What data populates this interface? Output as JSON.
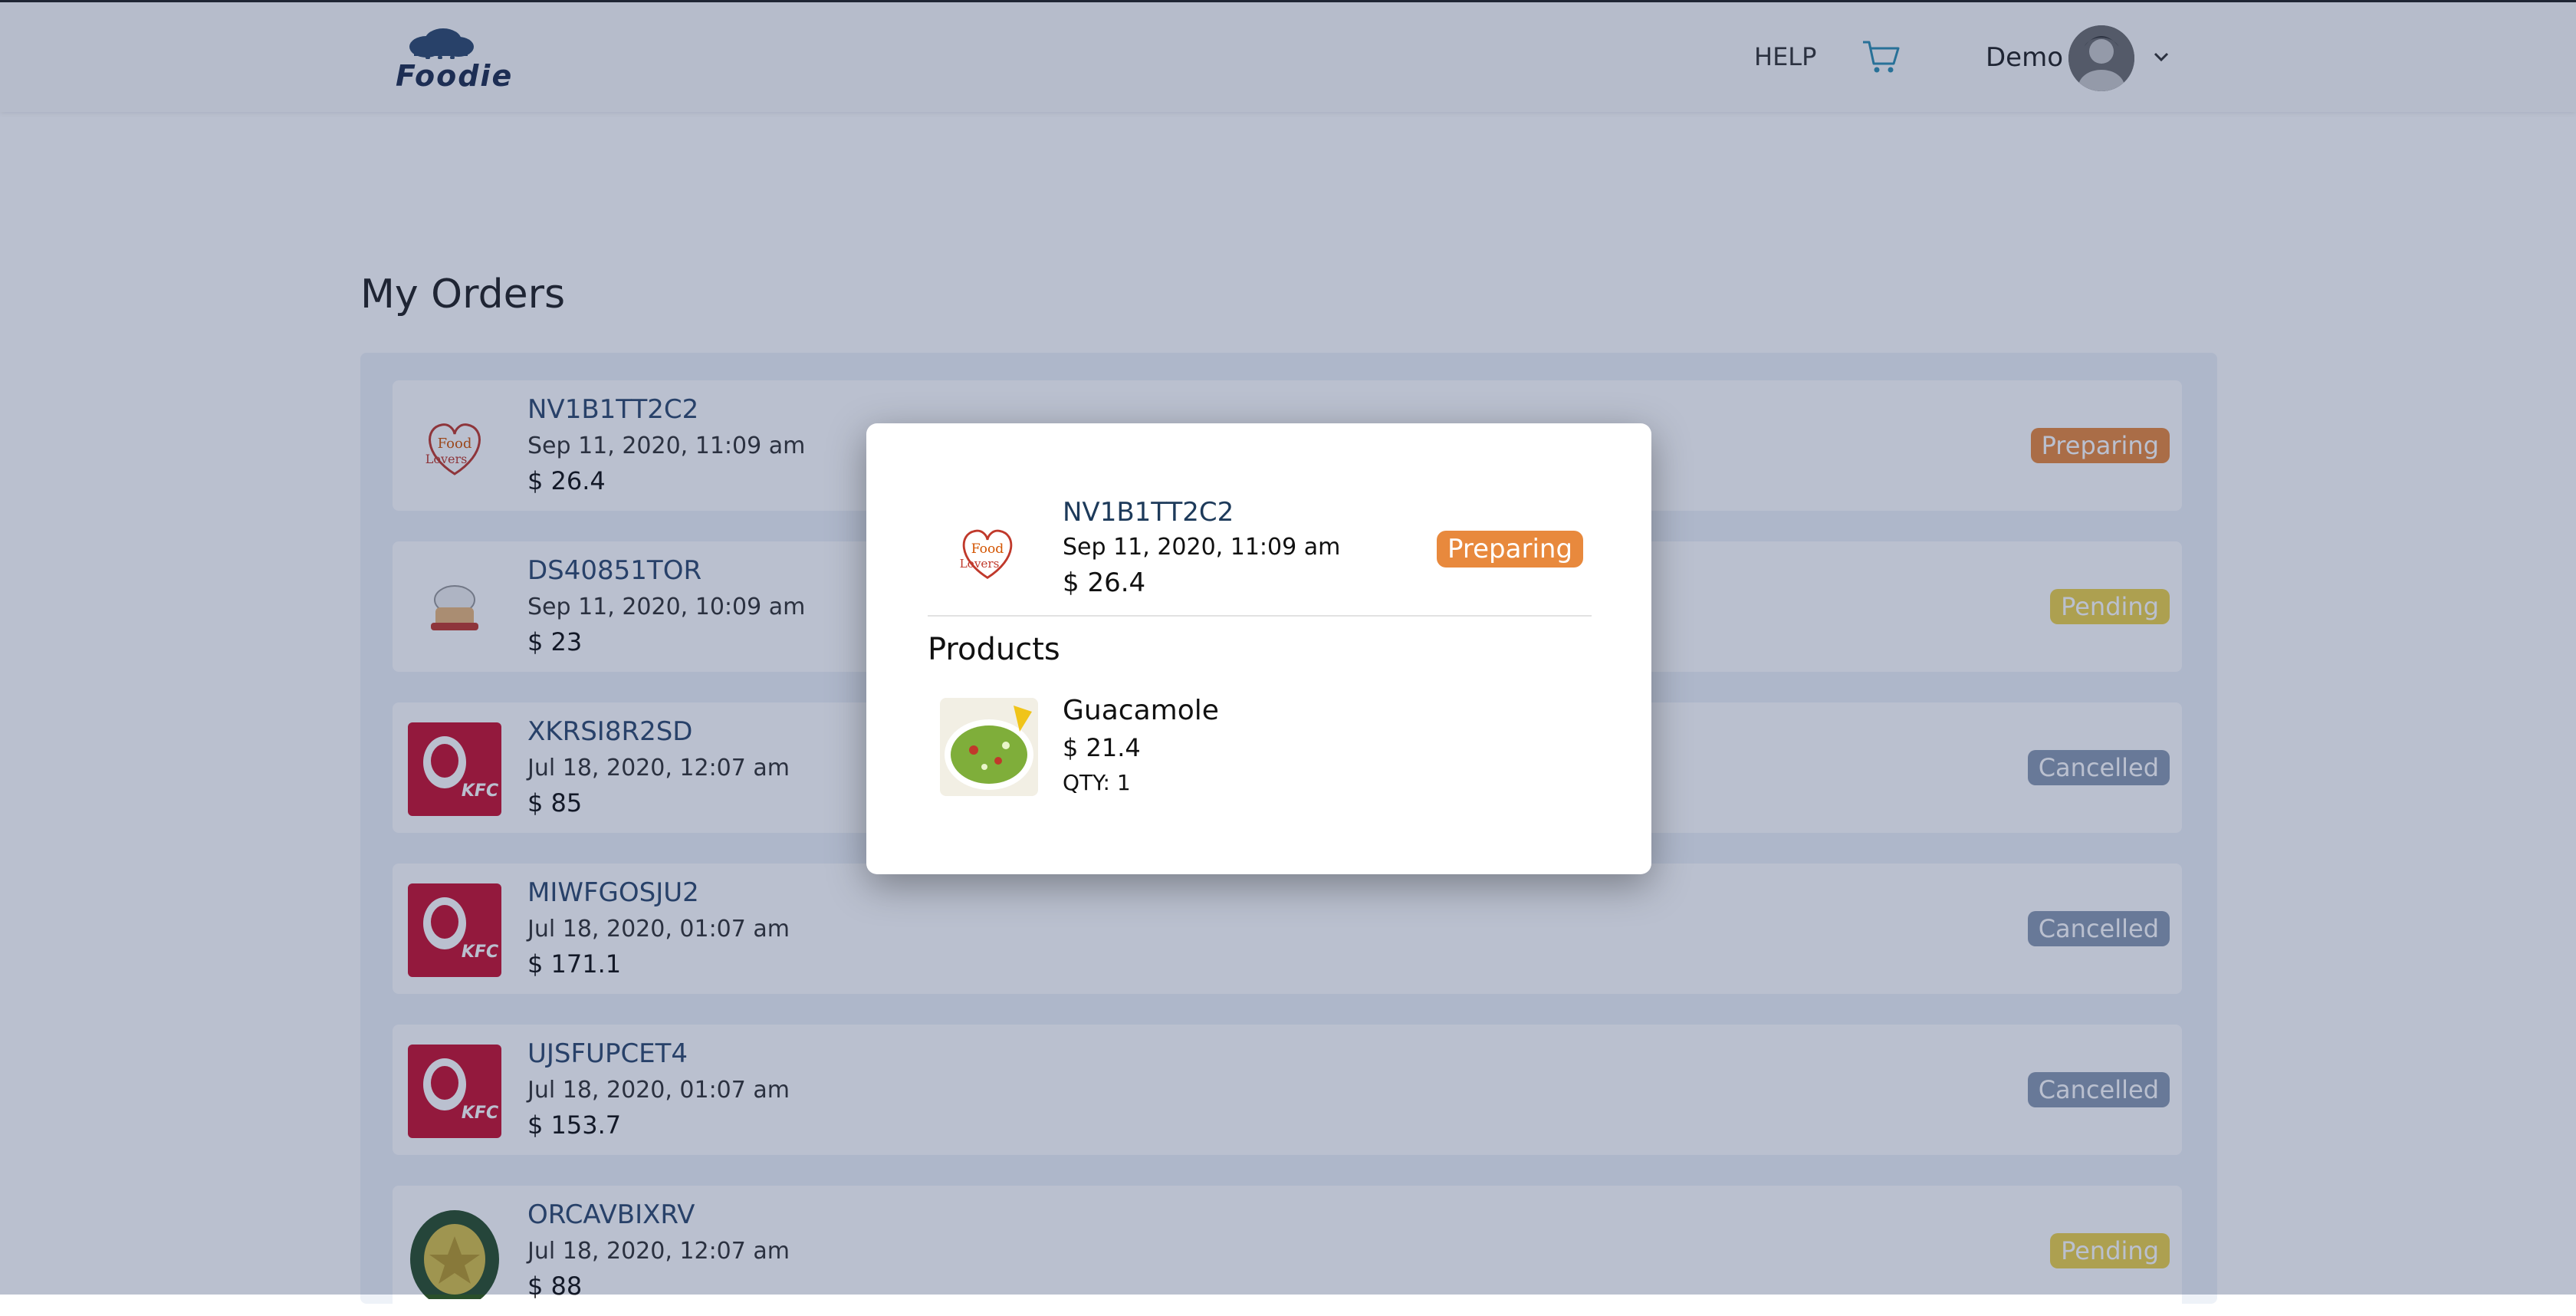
{
  "header": {
    "logo_text": "Foodie",
    "help_label": "HELP",
    "user_name": "Demo"
  },
  "page": {
    "title": "My Orders"
  },
  "orders": [
    {
      "code": "NV1B1TT2C2",
      "date": "Sep 11, 2020, 11:09 am",
      "total": "$ 26.4",
      "status": "Preparing",
      "status_color": "#e8893d",
      "thumb": "food-lovers-logo"
    },
    {
      "code": "DS40851TOR",
      "date": "Sep 11, 2020, 10:09 am",
      "total": "$ 23",
      "status": "Pending",
      "status_color": "#ecd24a",
      "thumb": "chef-logo"
    },
    {
      "code": "XKRSI8R2SD",
      "date": "Jul 18, 2020, 12:07 am",
      "total": "$ 85",
      "status": "Cancelled",
      "status_color": "#8a9ab0",
      "thumb": "kfc-logo"
    },
    {
      "code": "MIWFGOSJU2",
      "date": "Jul 18, 2020, 01:07 am",
      "total": "$ 171.1",
      "status": "Cancelled",
      "status_color": "#8a9ab0",
      "thumb": "kfc-logo"
    },
    {
      "code": "UJSFUPCET4",
      "date": "Jul 18, 2020, 01:07 am",
      "total": "$ 153.7",
      "status": "Cancelled",
      "status_color": "#8a9ab0",
      "thumb": "kfc-logo"
    },
    {
      "code": "ORCAVBIXRV",
      "date": "Jul 18, 2020, 12:07 am",
      "total": "$ 88",
      "status": "Pending",
      "status_color": "#ecd24a",
      "thumb": "restaurant-seal-logo"
    }
  ],
  "modal": {
    "code": "NV1B1TT2C2",
    "date": "Sep 11, 2020, 11:09 am",
    "total": "$ 26.4",
    "status": "Preparing",
    "products_heading": "Products",
    "product": {
      "name": "Guacamole",
      "price": "$ 21.4",
      "qty": "QTY: 1"
    }
  },
  "colors": {
    "preparing": "#e8893d",
    "pending": "#ecd24a",
    "cancelled": "#8a9ab0",
    "overlay": "#1c305f"
  }
}
